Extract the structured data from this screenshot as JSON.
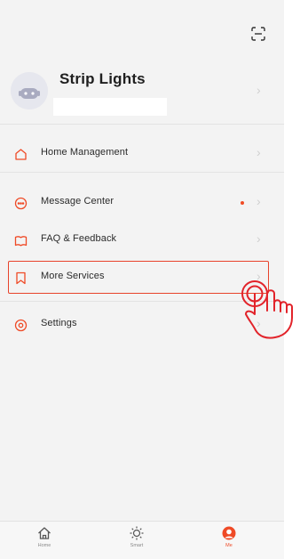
{
  "header": {
    "scan_icon": "scan-icon"
  },
  "profile": {
    "name": "Strip Lights",
    "avatar_icon": "robot-avatar-icon"
  },
  "menu": {
    "home_management": "Home Management",
    "message_center": "Message Center",
    "faq_feedback": "FAQ & Feedback",
    "more_services": "More Services",
    "settings": "Settings",
    "chevron": "›"
  },
  "tabs": [
    {
      "label": "Home",
      "icon": "home-icon",
      "active": false
    },
    {
      "label": "Smart",
      "icon": "sun-icon",
      "active": false
    },
    {
      "label": "Me",
      "icon": "me-icon",
      "active": true
    }
  ],
  "colors": {
    "accent": "#ef4a26",
    "highlight_box": "#e8432b",
    "background": "#f3f3f3"
  }
}
